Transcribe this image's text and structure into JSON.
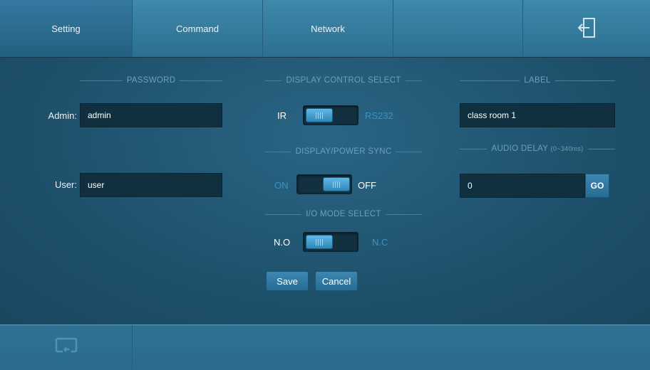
{
  "tabs": [
    {
      "label": "Setting",
      "active": true
    },
    {
      "label": "Command",
      "active": false
    },
    {
      "label": "Network",
      "active": false
    },
    {
      "label": "",
      "active": false
    }
  ],
  "header_icon": "logout-icon",
  "password": {
    "title": "PASSWORD",
    "admin_label": "Admin:",
    "admin_value": "admin",
    "user_label": "User:",
    "user_value": "user"
  },
  "display_control": {
    "title": "DISPLAY CONTROL SELECT",
    "left": "IR",
    "right": "RS232",
    "selected": "IR"
  },
  "power_sync": {
    "title": "DISPLAY/POWER SYNC",
    "left": "ON",
    "right": "OFF",
    "selected": "OFF"
  },
  "io_mode": {
    "title": "I/O MODE SELECT",
    "left": "N.O",
    "right": "N.C",
    "selected": "N.O"
  },
  "buttons": {
    "save": "Save",
    "cancel": "Cancel",
    "go": "GO"
  },
  "label": {
    "title": "LABEL",
    "value": "class room 1"
  },
  "audio_delay": {
    "title": "AUDIO DELAY",
    "range": "(0~340ms)",
    "value": "0"
  },
  "footer_icon": "return-icon",
  "colors": {
    "background": "#1d4f68",
    "tab_bar": "#3a82a4",
    "accent": "#3b93be",
    "field": "#11303f"
  }
}
